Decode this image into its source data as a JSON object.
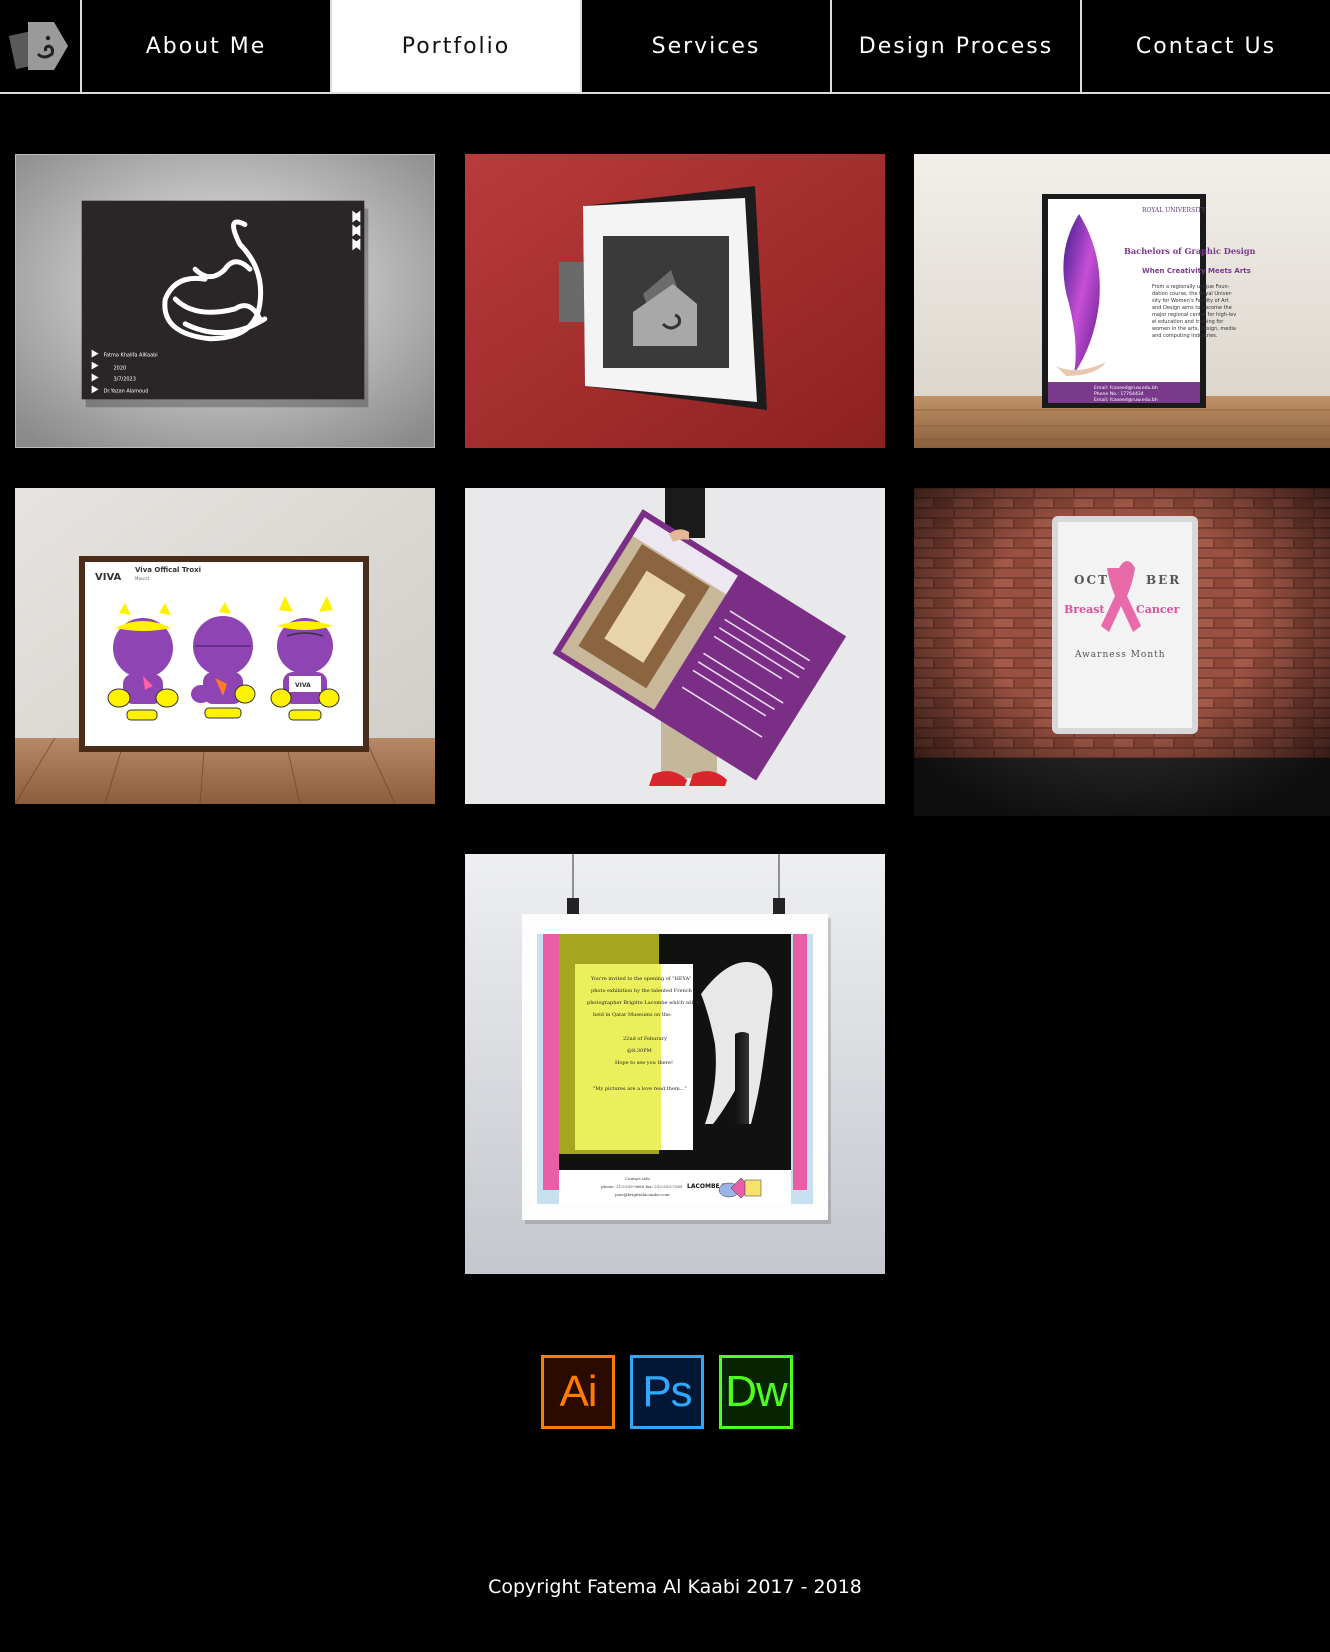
{
  "nav": {
    "items": [
      {
        "label": "About Me"
      },
      {
        "label": "Portfolio"
      },
      {
        "label": "Services"
      },
      {
        "label": "Design Process"
      },
      {
        "label": "Contact Us"
      }
    ],
    "active_index": 1
  },
  "portfolio": {
    "tile1": {
      "credits": [
        "Fatma Khalifa AlKaabi",
        "2020",
        "3/7/2023",
        "Dr.Yazan Alamoud"
      ]
    },
    "tile3": {
      "heading": "Bachelors of Graphic Design",
      "tagline": "When Creativity Meets Arts",
      "body": [
        "From a regionally unique Foun-",
        "dation course, the Royal Univer-",
        "sity for Women's Faculty of Art",
        "and Design aims to become the",
        "major regional center for high-lev",
        "el education and training for",
        "women in the arts, design, media",
        "and computing industries."
      ],
      "contact": [
        "Email: fcaseed@ruw.edu.bh",
        "Phone No.: 17764434",
        "Email: fcaseed@ruw.edu.bh"
      ]
    },
    "tile4": {
      "brand": "VIVA",
      "title": "Viva Offical Troxi",
      "subtitle": "Mascot"
    },
    "tile6": {
      "line1a": "OCT",
      "line1b": "BER",
      "line2a": "Breast",
      "line2b": "Cancer",
      "line3": "Awarness Month"
    },
    "tile7": {
      "invite": [
        "You're invited to the opening of \"HEYA\"",
        "photo exhibition by the talented French",
        "photographer Brigitte Lacombe which will be",
        "held in Qatar Museums on the:",
        "",
        "22nd of Feburary",
        "@8:30PM",
        "Hope to see you there!",
        "",
        "\"My pictures are a love read them...\""
      ],
      "contact_title": "Contact info",
      "contact": [
        "phone: 213-533-9680 fax: 212-533-7269",
        "jane@brigittelacombe.com"
      ],
      "brand": "LACOMBE BRIGITTE"
    }
  },
  "apps": [
    {
      "label": "Ai",
      "name": "illustrator"
    },
    {
      "label": "Ps",
      "name": "photoshop"
    },
    {
      "label": "Dw",
      "name": "dreamweaver"
    }
  ],
  "footer": {
    "copyright": "Copyright Fatema Al Kaabi 2017 - 2018"
  }
}
